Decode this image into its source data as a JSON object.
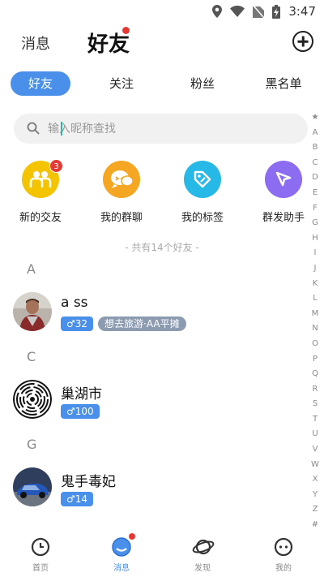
{
  "status_bar": {
    "time": "3:47"
  },
  "header": {
    "messages_label": "消息",
    "friends_label": "好友"
  },
  "tabs": [
    {
      "label": "好友"
    },
    {
      "label": "关注"
    },
    {
      "label": "粉丝"
    },
    {
      "label": "黑名单"
    }
  ],
  "search": {
    "placeholder": "输入昵称查找"
  },
  "shortcuts": [
    {
      "label": "新的交友",
      "badge": "3",
      "color": "#f5c400",
      "icon": "two-people-icon"
    },
    {
      "label": "我的群聊",
      "color": "#f5a623",
      "icon": "group-chat-icon"
    },
    {
      "label": "我的标签",
      "color": "#26b8e6",
      "icon": "tag-icon"
    },
    {
      "label": "群发助手",
      "color": "#8c6cf0",
      "icon": "send-arrow-icon"
    }
  ],
  "total_text": "- 共有14个好友 -",
  "sections": [
    {
      "letter": "A",
      "friends": [
        {
          "name": "a ss",
          "gender_age": "♂32",
          "note": "想去旅游·AA平摊"
        }
      ]
    },
    {
      "letter": "C",
      "friends": [
        {
          "name": "巢湖市",
          "gender_age": "♂100"
        }
      ]
    },
    {
      "letter": "G",
      "friends": [
        {
          "name": "鬼手毒妃",
          "gender_age": "♂14"
        }
      ]
    }
  ],
  "alphabet_index": [
    "★",
    "A",
    "B",
    "C",
    "D",
    "E",
    "F",
    "G",
    "H",
    "I",
    "J",
    "K",
    "L",
    "M",
    "N",
    "O",
    "P",
    "Q",
    "R",
    "S",
    "T",
    "U",
    "V",
    "W",
    "X",
    "Y",
    "Z",
    "#"
  ],
  "bottom_nav": [
    {
      "label": "首页",
      "icon": "clock-icon"
    },
    {
      "label": "消息",
      "icon": "chat-icon",
      "active": true
    },
    {
      "label": "发现",
      "icon": "planet-icon"
    },
    {
      "label": "我的",
      "icon": "face-icon"
    }
  ],
  "colors": {
    "accent": "#4a90ea",
    "badge": "#e53935"
  }
}
